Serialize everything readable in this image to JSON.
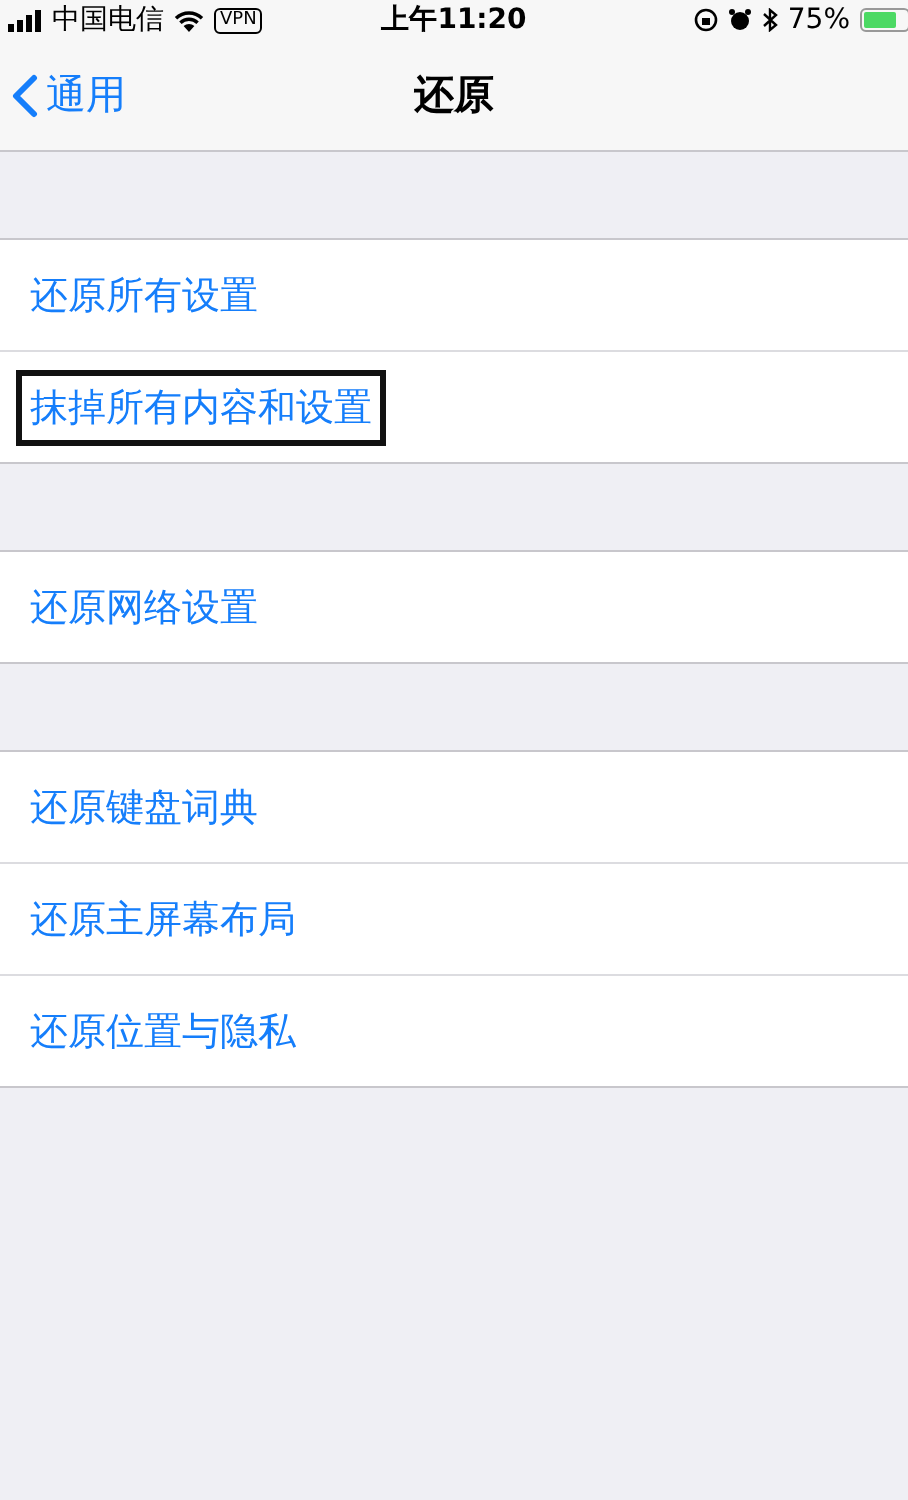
{
  "status_bar": {
    "carrier": "中国电信",
    "vpn": "VPN",
    "time": "上午11:20",
    "battery": "75%"
  },
  "nav": {
    "back": "通用",
    "title": "还原"
  },
  "groups": [
    {
      "items": [
        {
          "label": "还原所有设置",
          "highlighted": false
        },
        {
          "label": "抹掉所有内容和设置",
          "highlighted": true
        }
      ]
    },
    {
      "items": [
        {
          "label": "还原网络设置",
          "highlighted": false
        }
      ]
    },
    {
      "items": [
        {
          "label": "还原键盘词典",
          "highlighted": false
        },
        {
          "label": "还原主屏幕布局",
          "highlighted": false
        },
        {
          "label": "还原位置与隐私",
          "highlighted": false
        }
      ]
    }
  ]
}
